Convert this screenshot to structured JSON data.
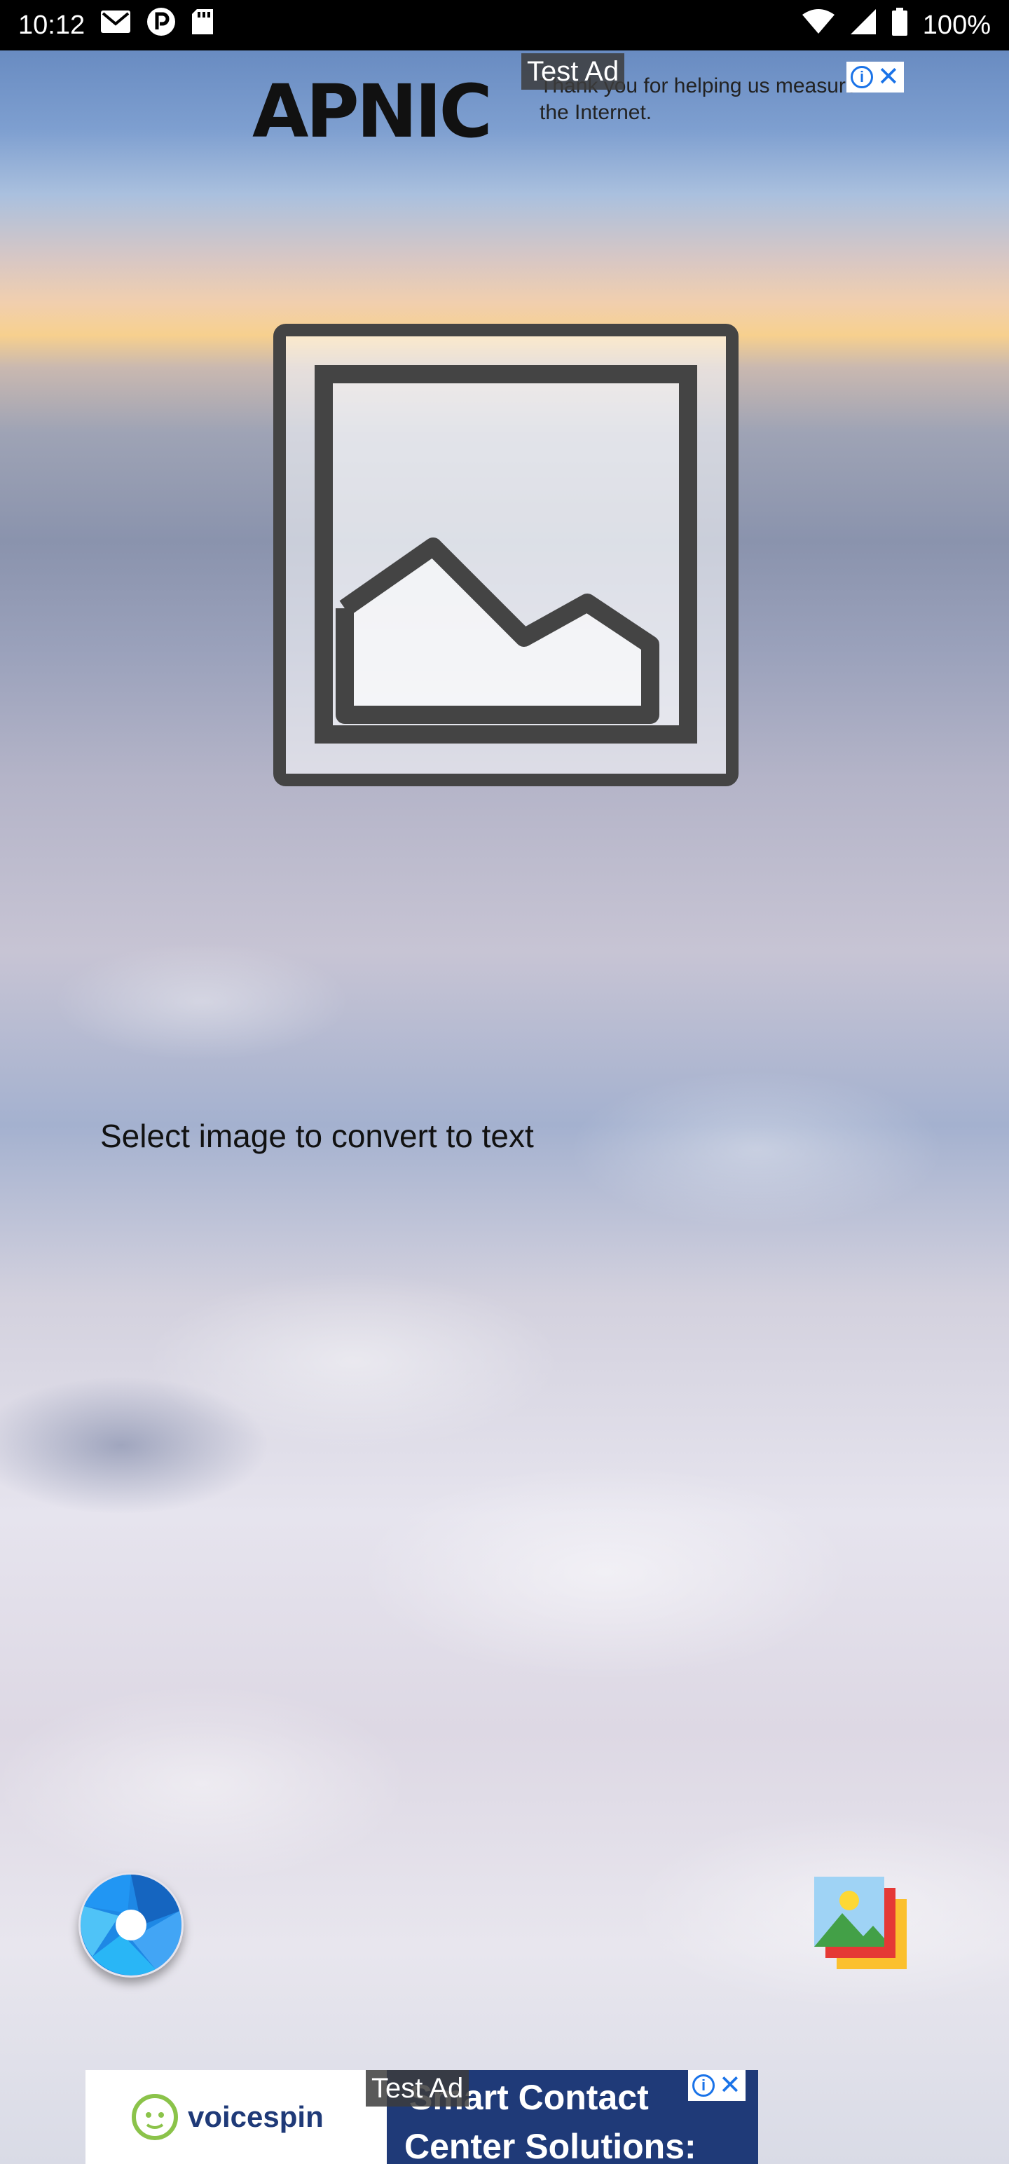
{
  "status_bar": {
    "time": "10:12",
    "battery_percent": "100%",
    "icons": [
      "gmail-icon",
      "pandora-icon",
      "sd-card-icon",
      "wifi-icon",
      "signal-icon",
      "battery-icon"
    ]
  },
  "top_ad": {
    "label": "Test Ad",
    "brand": "APNIC",
    "text_line1": "Thank you for helping us measure",
    "text_line2": "the Internet."
  },
  "main": {
    "placeholder_icon": "image-placeholder-icon",
    "prompt": "Select image to convert to text"
  },
  "buttons": {
    "camera": "camera-shutter-icon",
    "gallery": "gallery-icon"
  },
  "bottom_ad": {
    "label": "Test Ad",
    "brand": "voicespin",
    "line1": "Smart Contact",
    "line2": "Center Solutions:"
  },
  "colors": {
    "status_bar": "#000000",
    "ad_choice_blue": "#1a73e8",
    "camera_blue": "#1e88e5",
    "bottom_ad_bg": "#1f3a78"
  }
}
